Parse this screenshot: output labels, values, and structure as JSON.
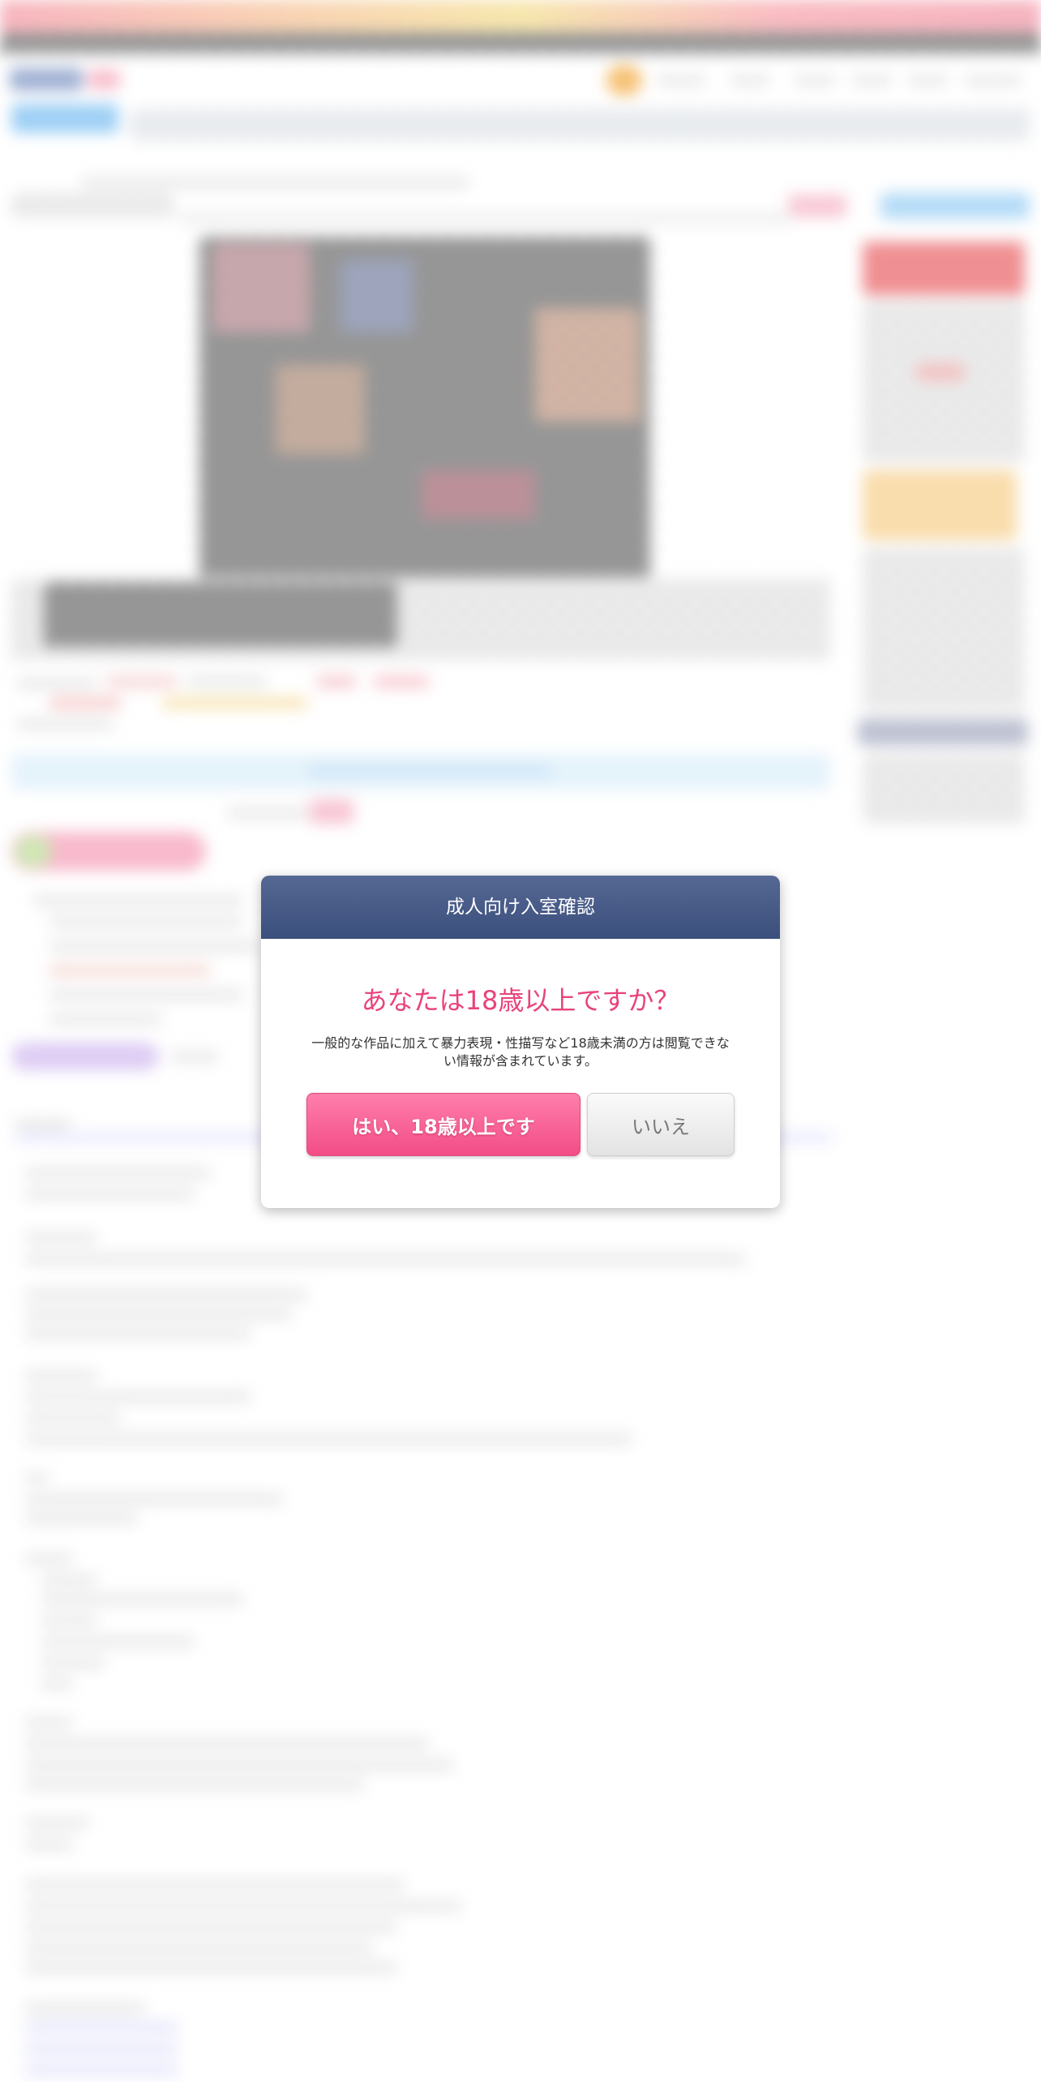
{
  "age_gate": {
    "title": "成人向け入室確認",
    "question": "あなたは18歳以上ですか？",
    "description": "一般的な作品に加えて暴力表現・性描写など18歳未満の方は閲覧できない情報が含まれています。",
    "yes_button": "はい、18歳以上です",
    "no_button": "いいえ"
  },
  "colors": {
    "header_bg": "#46597f",
    "question_text": "#e8437d",
    "yes_button_bg": "#f5568d",
    "no_button_bg": "#eeeeee"
  }
}
